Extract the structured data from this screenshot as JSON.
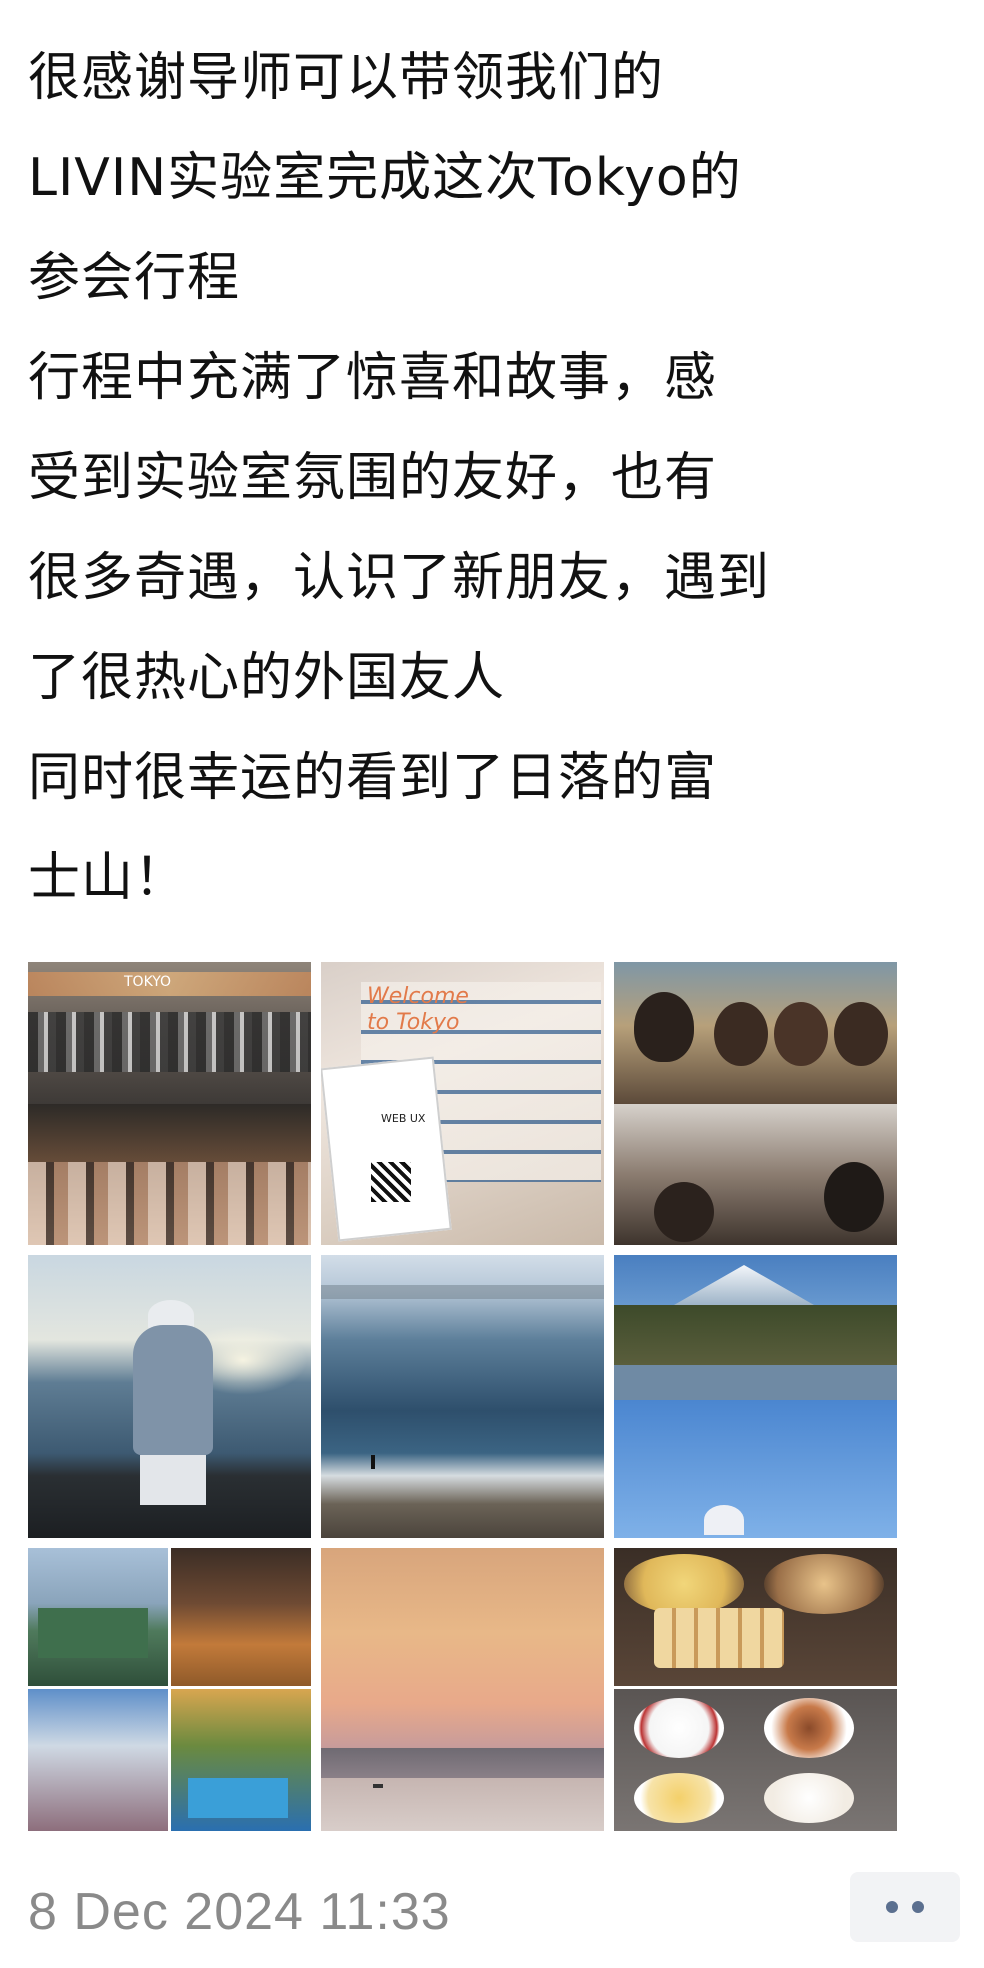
{
  "post": {
    "lines": [
      "很感谢导师可以带领我们的",
      "LIVIN实验室完成这次Tokyo的",
      "参会行程",
      "行程中充满了惊喜和故事，感",
      "受到实验室氛围的友好，也有",
      "很多奇遇，认识了新朋友，遇到",
      "了很热心的外国友人",
      "同时很幸运的看到了日落的富",
      "士山！"
    ]
  },
  "photos": {
    "p1_banner": "TOKYO",
    "p2_welcome": "Welcome to Tokyo",
    "p2_card": "WEB UX"
  },
  "footer": {
    "timestamp": "8 Dec 2024 11:33"
  },
  "icons": {
    "more": "more-options-icon"
  }
}
